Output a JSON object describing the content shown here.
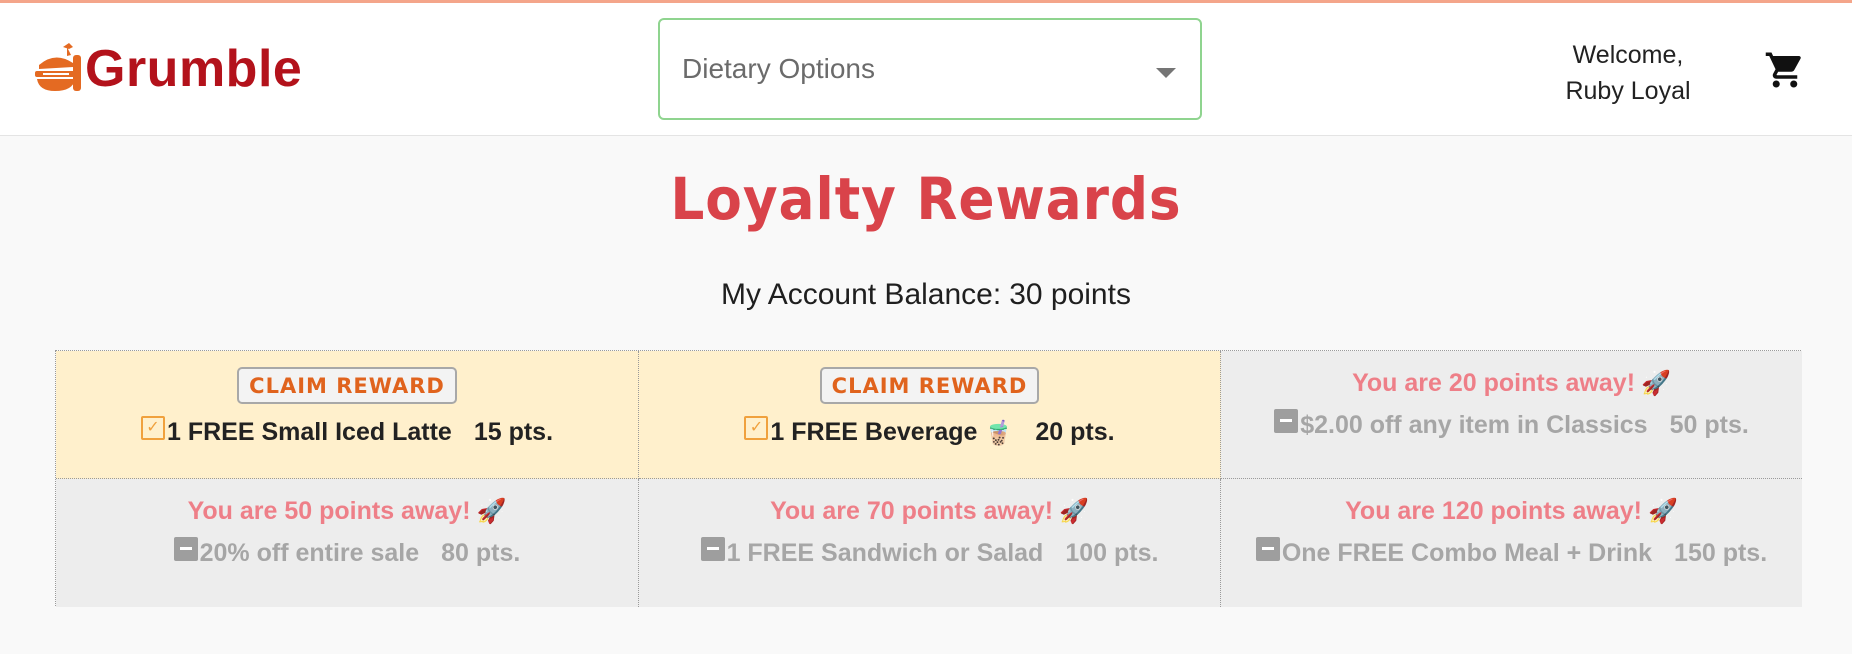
{
  "header": {
    "brand_name": "Grumble",
    "dietary_placeholder": "Dietary Options",
    "welcome_line1": "Welcome,",
    "welcome_line2": "Ruby Loyal",
    "cart_icon": "shopping-cart-icon",
    "logo_icon": "burger-logo-icon"
  },
  "page": {
    "title": "Loyalty Rewards",
    "balance_label": "My Account Balance:",
    "balance_value": "30 points"
  },
  "colors": {
    "brand": "#b3121b",
    "title": "#d9434a",
    "claim_text": "#e0631d",
    "away_text": "#ee7f88",
    "claimable_bg": "#fff0cc",
    "locked_bg": "#ededed",
    "dietary_border": "#8fd48f"
  },
  "rewards": [
    {
      "status": "claimable",
      "button_label": "CLAIM REWARD",
      "name": "1 FREE Small Iced Latte",
      "points": "15 pts."
    },
    {
      "status": "claimable",
      "button_label": "CLAIM REWARD",
      "name": "1 FREE Beverage",
      "name_emoji": "🧋",
      "points": "20 pts."
    },
    {
      "status": "locked",
      "away_text": "You are 20 points away!",
      "away_emoji": "🚀",
      "name": "$2.00 off any item in Classics",
      "points": "50 pts."
    },
    {
      "status": "locked",
      "away_text": "You are 50 points away!",
      "away_emoji": "🚀",
      "name": "20% off entire sale",
      "points": "80 pts."
    },
    {
      "status": "locked",
      "away_text": "You are 70 points away!",
      "away_emoji": "🚀",
      "name": "1 FREE Sandwich or Salad",
      "points": "100 pts."
    },
    {
      "status": "locked",
      "away_text": "You are 120 points away!",
      "away_emoji": "🚀",
      "name": "One FREE Combo Meal + Drink",
      "points": "150 pts."
    }
  ]
}
